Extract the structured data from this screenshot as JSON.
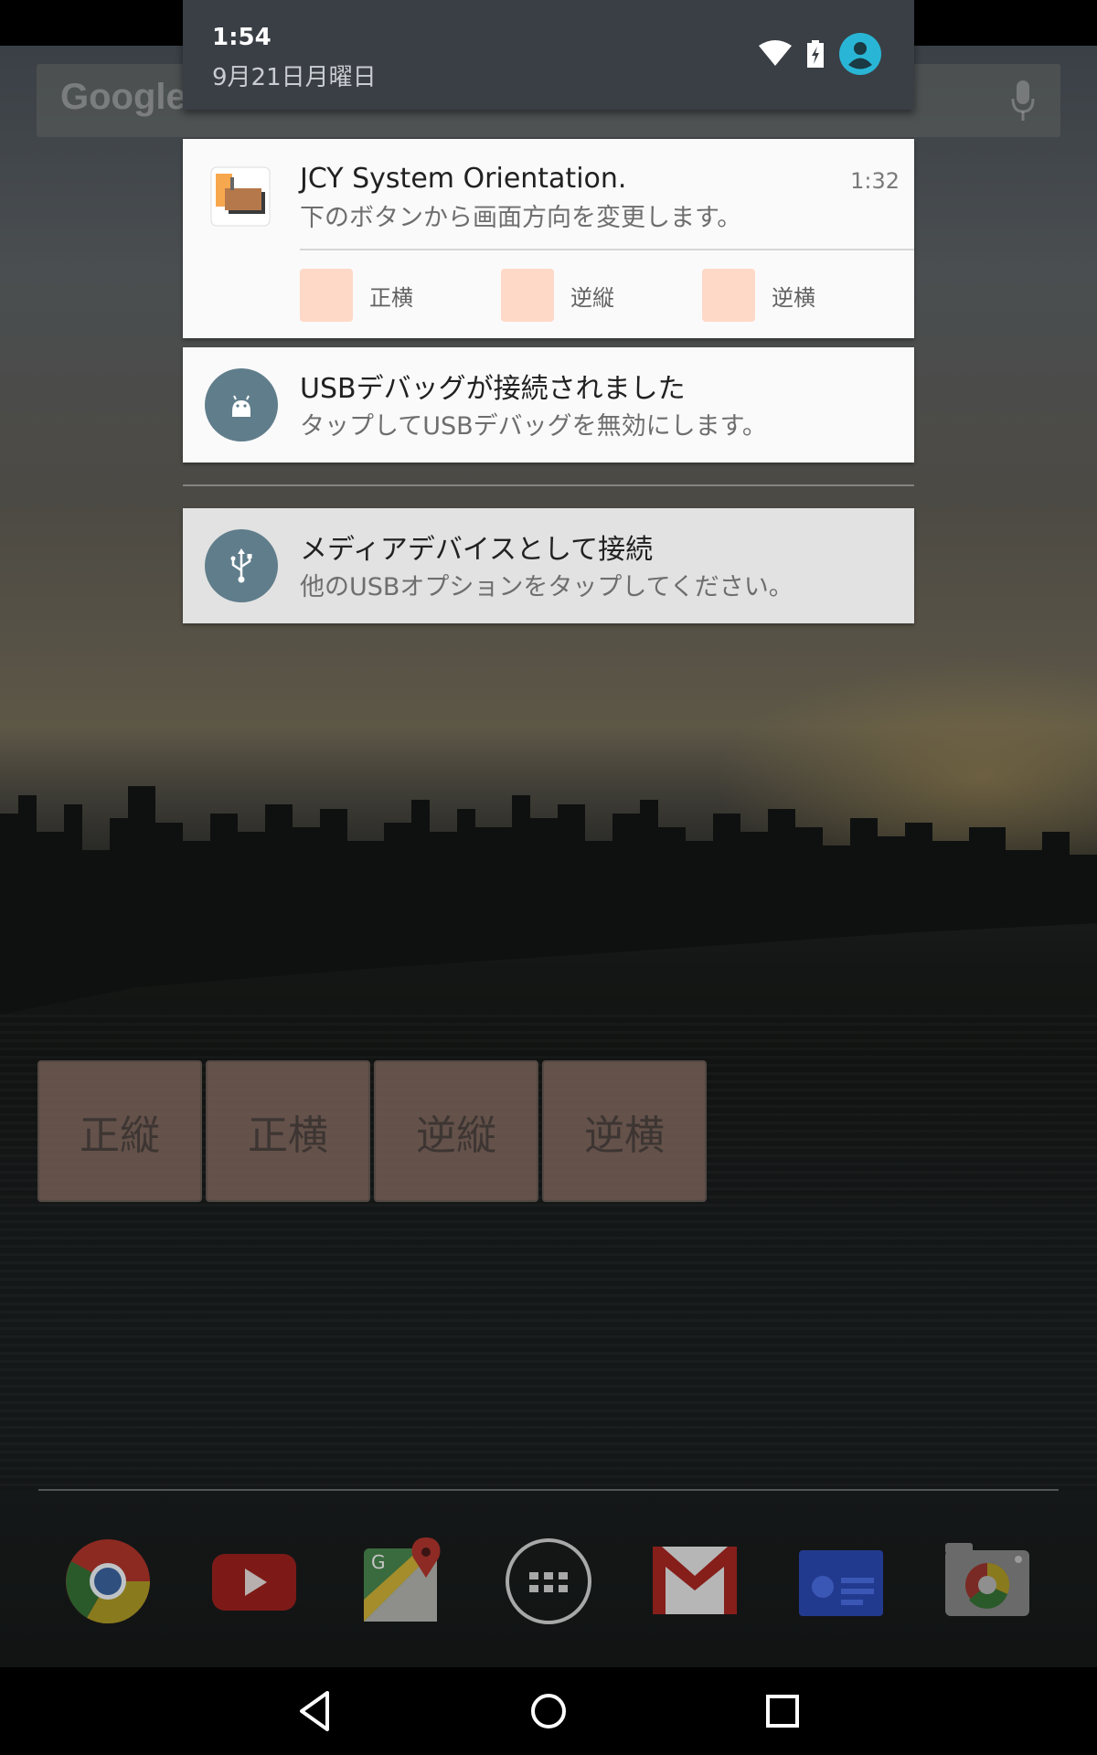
{
  "status_header": {
    "time": "1:54",
    "date": "9月21日月曜日",
    "icons": [
      "wifi-icon",
      "battery-charging-icon",
      "account-icon"
    ]
  },
  "search": {
    "text": "Google",
    "icon": "mic-icon"
  },
  "notifications": [
    {
      "app_icon": "jcy-orientation-app-icon",
      "title": "JCY System Orientation.",
      "subtitle": "下のボタンから画面方向を変更します。",
      "time": "1:32",
      "actions": [
        {
          "label": "正横"
        },
        {
          "label": "逆縦"
        },
        {
          "label": "逆横"
        }
      ]
    },
    {
      "app_icon": "android-debug-icon",
      "title": "USBデバッグが接続されました",
      "subtitle": "タップしてUSBデバッグを無効にします。"
    },
    {
      "app_icon": "usb-icon",
      "title": "メディアデバイスとして接続",
      "subtitle": "他のUSBオプションをタップしてください。"
    }
  ],
  "widget": {
    "buttons": [
      {
        "label": "正縦"
      },
      {
        "label": "正横"
      },
      {
        "label": "逆縦"
      },
      {
        "label": "逆横"
      }
    ]
  },
  "dock": [
    "chrome-icon",
    "youtube-icon",
    "maps-icon",
    "app-drawer-icon",
    "gmail-icon",
    "news-icon",
    "camera-icon"
  ],
  "navbar": [
    "back-icon",
    "home-icon",
    "recents-icon"
  ],
  "colors": {
    "shade_header": "#3a3f45",
    "card": "#fafafa",
    "action_square": "#ffd9c7",
    "round_icon": "#607d8b",
    "account_accent": "#29b6d6"
  }
}
